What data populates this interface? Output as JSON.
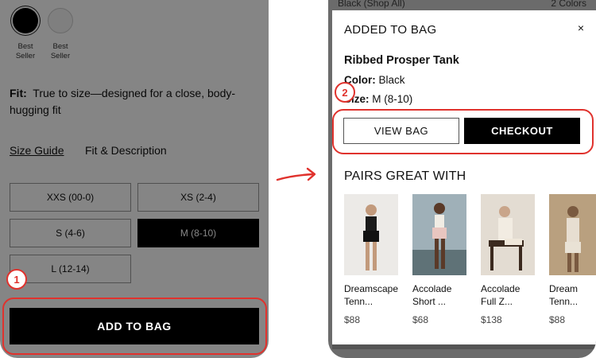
{
  "left_screen": {
    "swatches": [
      {
        "label_line1": "Best",
        "label_line2": "Seller",
        "color": "#000000"
      },
      {
        "label_line1": "Best",
        "label_line2": "Seller",
        "color": "#f4f4f4"
      }
    ],
    "fit_label": "Fit:",
    "fit_text": "True to size—designed for a close, body-hugging fit",
    "links": {
      "size_guide": "Size Guide",
      "fit_description": "Fit & Description"
    },
    "sizes": [
      "XXS (00-0)",
      "XS (2-4)",
      "S (4-6)",
      "M (8-10)",
      "L (12-14)"
    ],
    "selected_size": "M (8-10)",
    "add_to_bag_label": "ADD TO BAG",
    "step_badge": "1"
  },
  "right_screen": {
    "background_text_left": "Black (Shop All)",
    "background_text_right": "2 Colors",
    "modal_title": "ADDED TO BAG",
    "close_icon": "×",
    "product_name": "Ribbed Prosper Tank",
    "color_label": "Color:",
    "color_value": "Black",
    "size_label": "Size:",
    "size_value": "M (8-10)",
    "view_bag_label": "VIEW BAG",
    "checkout_label": "CHECKOUT",
    "pairs_heading": "PAIRS GREAT WITH",
    "step_badge": "2",
    "recommendations": [
      {
        "name_line1": "Dreamscape",
        "name_line2": "Tenn...",
        "price": "$88"
      },
      {
        "name_line1": "Accolade",
        "name_line2": "Short ...",
        "price": "$68"
      },
      {
        "name_line1": "Accolade",
        "name_line2": "Full Z...",
        "price": "$138"
      },
      {
        "name_line1": "Dream",
        "name_line2": "Tenn...",
        "price": "$88"
      }
    ]
  },
  "accent_color": "#e0322d"
}
